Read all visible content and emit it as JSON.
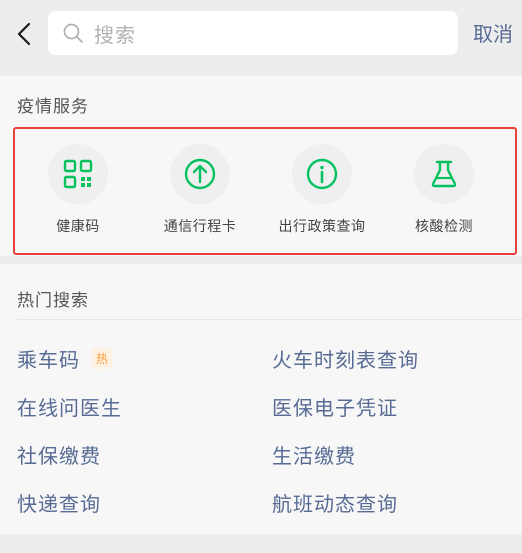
{
  "search": {
    "placeholder": "搜索",
    "cancel_label": "取消"
  },
  "epidemic": {
    "title": "疫情服务",
    "items": [
      {
        "label": "健康码",
        "icon": "qr-code-icon"
      },
      {
        "label": "通信行程卡",
        "icon": "arrow-up-circle-icon"
      },
      {
        "label": "出行政策查询",
        "icon": "info-icon"
      },
      {
        "label": "核酸检测",
        "icon": "flask-icon"
      }
    ]
  },
  "hot": {
    "title": "热门搜索",
    "badge": "热",
    "items": [
      "乘车码",
      "火车时刻表查询",
      "在线问医生",
      "医保电子凭证",
      "社保缴费",
      "生活缴费",
      "快递查询",
      "航班动态查询"
    ]
  },
  "colors": {
    "accent_green": "#07c160",
    "link_blue": "#576b95",
    "highlight_red": "#e8413b",
    "badge_orange": "#fa9d3b"
  }
}
